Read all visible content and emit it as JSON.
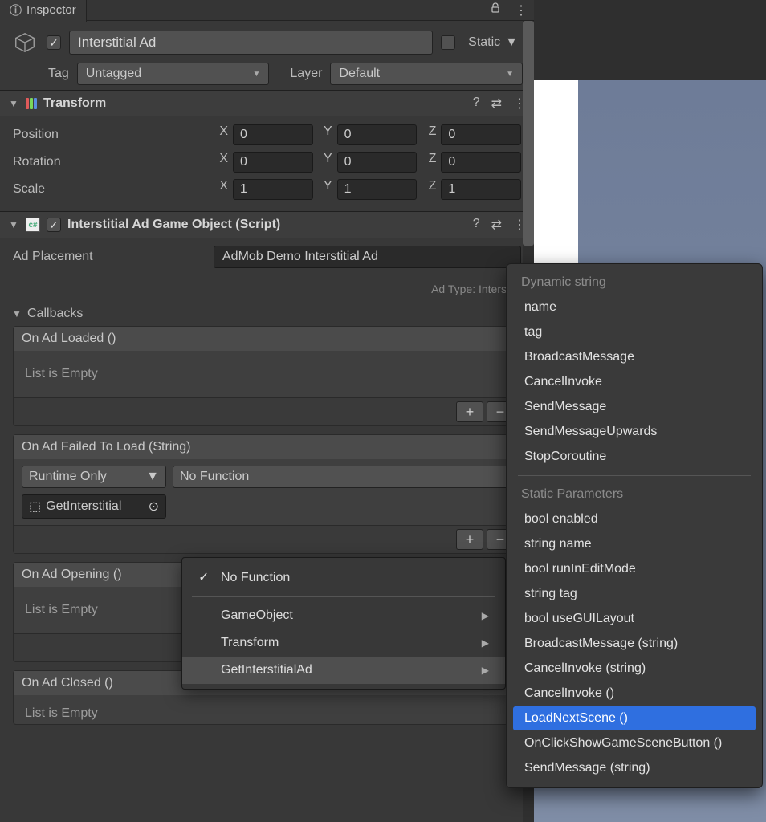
{
  "tab": {
    "title": "Inspector"
  },
  "object": {
    "enabled": true,
    "name": "Interstitial Ad",
    "static_label": "Static",
    "tag_label": "Tag",
    "tag_value": "Untagged",
    "layer_label": "Layer",
    "layer_value": "Default"
  },
  "transform": {
    "title": "Transform",
    "position_label": "Position",
    "rotation_label": "Rotation",
    "scale_label": "Scale",
    "x_label": "X",
    "y_label": "Y",
    "z_label": "Z",
    "position": {
      "x": "0",
      "y": "0",
      "z": "0"
    },
    "rotation": {
      "x": "0",
      "y": "0",
      "z": "0"
    },
    "scale": {
      "x": "1",
      "y": "1",
      "z": "1"
    }
  },
  "script": {
    "title": "Interstitial Ad Game Object (Script)",
    "ad_placement_label": "Ad Placement",
    "ad_placement_value": "AdMob Demo Interstitial Ad",
    "ad_type_hint": "Ad Type: Interstiti"
  },
  "callbacks": {
    "title": "Callbacks",
    "events": [
      {
        "name": "On Ad Loaded ()",
        "empty": "List is Empty"
      },
      {
        "name": "On Ad Failed To Load (String)",
        "runtime": "Runtime Only",
        "func": "No Function",
        "target": "GetInterstitial"
      },
      {
        "name": "On Ad Opening ()",
        "empty": "List is Empty"
      },
      {
        "name": "On Ad Closed ()",
        "empty": "List is Empty"
      }
    ]
  },
  "func_menu": {
    "no_function": "No Function",
    "items": [
      "GameObject",
      "Transform",
      "GetInterstitialAd"
    ],
    "selected": "GetInterstitialAd"
  },
  "method_menu": {
    "group1": "Dynamic string",
    "opts1": [
      "name",
      "tag",
      "BroadcastMessage",
      "CancelInvoke",
      "SendMessage",
      "SendMessageUpwards",
      "StopCoroutine"
    ],
    "group2": "Static Parameters",
    "opts2": [
      "bool enabled",
      "string name",
      "bool runInEditMode",
      "string tag",
      "bool useGUILayout",
      "BroadcastMessage (string)",
      "CancelInvoke (string)",
      "CancelInvoke ()",
      "LoadNextScene ()",
      "OnClickShowGameSceneButton ()",
      "SendMessage (string)"
    ],
    "highlight": "LoadNextScene ()"
  }
}
